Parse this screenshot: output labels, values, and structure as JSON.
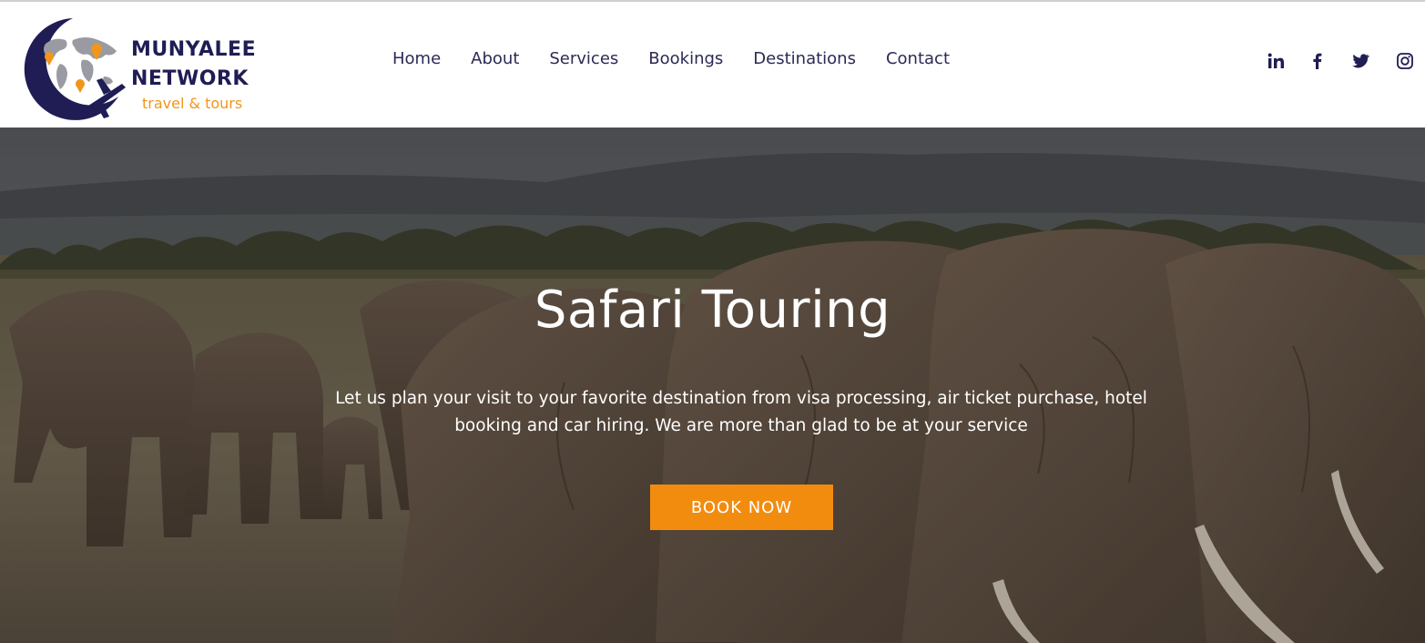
{
  "logo": {
    "brand_line1": "MUNYALEE",
    "brand_line2": "NETWORK",
    "tagline": "travel & tours",
    "colors": {
      "navy": "#1f1d54",
      "orange": "#f0961a"
    }
  },
  "nav": {
    "items": [
      {
        "label": "Home"
      },
      {
        "label": "About"
      },
      {
        "label": "Services"
      },
      {
        "label": "Bookings"
      },
      {
        "label": "Destinations"
      },
      {
        "label": "Contact"
      }
    ]
  },
  "social": {
    "icons": [
      "linkedin-icon",
      "facebook-icon",
      "twitter-icon",
      "instagram-icon"
    ]
  },
  "hero": {
    "title": "Safari Touring",
    "text": "Let us plan your visit to your favorite destination from visa processing, air ticket purchase, hotel booking and car hiring. We are more than glad to be at your service",
    "cta_label": "BOOK NOW",
    "cta_color": "#f28c0f"
  }
}
